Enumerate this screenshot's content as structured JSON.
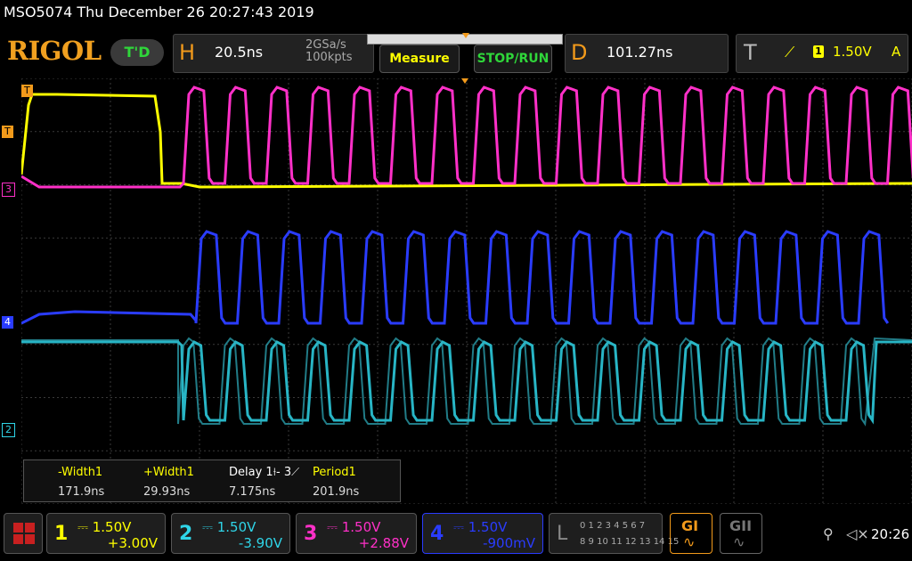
{
  "status": {
    "model_datetime": "MSO5074  Thu December 26 20:27:43 2019"
  },
  "header": {
    "logo": "RIGOL",
    "td_label": "T'D",
    "horizontal": {
      "letter": "H",
      "timebase": "20.5ns",
      "sample_rate": "2GSa/s",
      "memory_depth": "100kpts"
    },
    "measure_label": "Measure",
    "stoprun_label": "STOP/RUN",
    "delay": {
      "letter": "D",
      "value": "101.27ns"
    },
    "trigger": {
      "letter": "T",
      "edge": "⟋",
      "source": "1",
      "level": "1.50V",
      "mode": "A"
    }
  },
  "markers": {
    "trigger_level": "T",
    "trigger_pos": "T",
    "ch3": "3",
    "ch4": "4",
    "ch2": "2"
  },
  "measurements": [
    {
      "label": "-Width1",
      "value": "171.9ns",
      "color": "#ffff00"
    },
    {
      "label": "+Width1",
      "value": "29.93ns",
      "color": "#ffff00"
    },
    {
      "label": "Delay 1⟊- 3⟋",
      "value": "7.175ns",
      "color": "#ffffff"
    },
    {
      "label": "Period1",
      "value": "201.9ns",
      "color": "#ffff00"
    }
  ],
  "channels": [
    {
      "num": "1",
      "scale": "1.50V",
      "offset": "+3.00V",
      "color": "#ffff00"
    },
    {
      "num": "2",
      "scale": "1.50V",
      "offset": "-3.90V",
      "color": "#2fd5e8"
    },
    {
      "num": "3",
      "scale": "1.50V",
      "offset": "+2.88V",
      "color": "#ff30c8"
    },
    {
      "num": "4",
      "scale": "1.50V",
      "offset": "-900mV",
      "color": "#2a3cff"
    }
  ],
  "logic": {
    "letter": "L",
    "row1": "0 1 2 3  4 5 6 7",
    "row2": "8 9 10 11 12 13 14 15"
  },
  "generators": [
    {
      "label": "GI"
    },
    {
      "label": "GII"
    }
  ],
  "system": {
    "time": "20:26",
    "usb": "⚲",
    "sound": "◁×"
  },
  "colors": {
    "ch1": "#ffff00",
    "ch2": "#2fd5e8",
    "ch3": "#ff30c8",
    "ch4": "#2a3cff",
    "accent": "#f29a1b",
    "run": "#2fd63a"
  }
}
